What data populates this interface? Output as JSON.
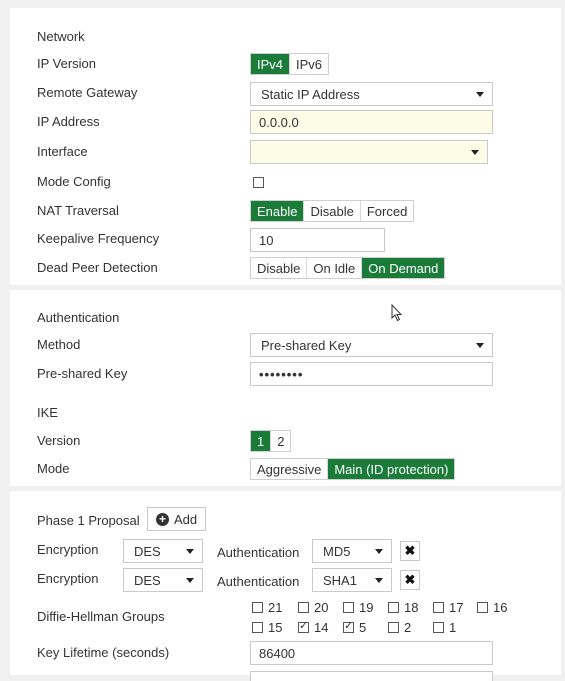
{
  "network": {
    "heading": "Network",
    "ip_version_label": "IP Version",
    "ip_version_options": [
      "IPv4",
      "IPv6"
    ],
    "ip_version_selected": "IPv4",
    "remote_gateway_label": "Remote Gateway",
    "remote_gateway_value": "Static IP Address",
    "ip_address_label": "IP Address",
    "ip_address_value": "0.0.0.0",
    "interface_label": "Interface",
    "interface_value": "",
    "mode_config_label": "Mode Config",
    "mode_config_checked": false,
    "nat_label": "NAT Traversal",
    "nat_options": [
      "Enable",
      "Disable",
      "Forced"
    ],
    "nat_selected": "Enable",
    "keepalive_label": "Keepalive Frequency",
    "keepalive_value": "10",
    "dpd_label": "Dead Peer Detection",
    "dpd_options": [
      "Disable",
      "On Idle",
      "On Demand"
    ],
    "dpd_selected": "On Demand"
  },
  "authentication": {
    "heading": "Authentication",
    "method_label": "Method",
    "method_value": "Pre-shared Key",
    "psk_label": "Pre-shared Key",
    "psk_value": "••••••••"
  },
  "ike": {
    "heading": "IKE",
    "version_label": "Version",
    "version_options": [
      "1",
      "2"
    ],
    "version_selected": "1",
    "mode_label": "Mode",
    "mode_options": [
      "Aggressive",
      "Main (ID protection)"
    ],
    "mode_selected": "Main (ID protection)"
  },
  "phase1": {
    "heading": "Phase 1 Proposal",
    "add_label": "Add",
    "proposals": [
      {
        "enc_label": "Encryption",
        "enc_value": "DES",
        "auth_label": "Authentication",
        "auth_value": "MD5"
      },
      {
        "enc_label": "Encryption",
        "enc_value": "DES",
        "auth_label": "Authentication",
        "auth_value": "SHA1"
      }
    ],
    "dh_label": "Diffie-Hellman Groups",
    "dh_groups": [
      {
        "label": "21",
        "checked": false
      },
      {
        "label": "20",
        "checked": false
      },
      {
        "label": "19",
        "checked": false
      },
      {
        "label": "18",
        "checked": false
      },
      {
        "label": "17",
        "checked": false
      },
      {
        "label": "16",
        "checked": false
      },
      {
        "label": "15",
        "checked": false
      },
      {
        "label": "14",
        "checked": true
      },
      {
        "label": "5",
        "checked": true
      },
      {
        "label": "2",
        "checked": false
      },
      {
        "label": "1",
        "checked": false
      }
    ],
    "key_lifetime_label": "Key Lifetime (seconds)",
    "key_lifetime_value": "86400"
  },
  "colors": {
    "accent": "#1b7c3a",
    "input_highlight": "#fdfce6"
  },
  "icons": {
    "remove": "close-icon",
    "add": "plus-circle-icon",
    "cursor": "mouse-pointer-icon"
  }
}
